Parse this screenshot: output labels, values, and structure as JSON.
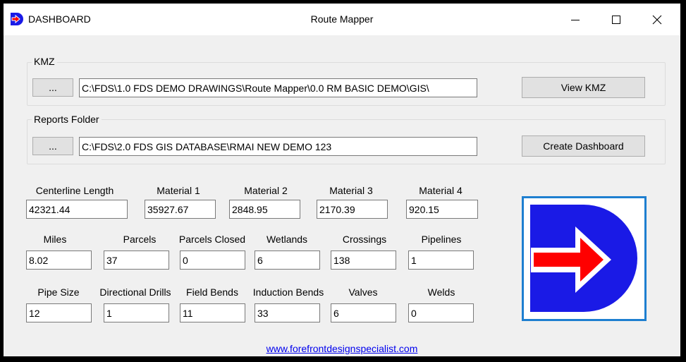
{
  "window": {
    "app_name": "DASHBOARD",
    "title": "Route Mapper",
    "icons": {
      "app": "fds-logo-icon",
      "minimize": "minimize-icon",
      "maximize": "maximize-icon",
      "close": "close-icon"
    }
  },
  "kmz": {
    "group_label": "KMZ",
    "browse_label": "...",
    "path": "C:\\FDS\\1.0 FDS DEMO DRAWINGS\\Route Mapper\\0.0 RM BASIC DEMO\\GIS\\",
    "action_label": "View KMZ"
  },
  "reports": {
    "group_label": "Reports Folder",
    "browse_label": "...",
    "path": "C:\\FDS\\2.0 FDS GIS DATABASE\\RMAI NEW DEMO 123",
    "action_label": "Create Dashboard"
  },
  "fields": {
    "centerline_length": {
      "label": "Centerline Length",
      "value": "42321.44"
    },
    "material_1": {
      "label": "Material 1",
      "value": "35927.67"
    },
    "material_2": {
      "label": "Material 2",
      "value": "2848.95"
    },
    "material_3": {
      "label": "Material 3",
      "value": "2170.39"
    },
    "material_4": {
      "label": "Material 4",
      "value": "920.15"
    },
    "miles": {
      "label": "Miles",
      "value": "8.02"
    },
    "parcels": {
      "label": "Parcels",
      "value": "37"
    },
    "parcels_closed": {
      "label": "Parcels Closed",
      "value": "0"
    },
    "wetlands": {
      "label": "Wetlands",
      "value": "6"
    },
    "crossings": {
      "label": "Crossings",
      "value": "138"
    },
    "pipelines": {
      "label": "Pipelines",
      "value": "1"
    },
    "pipe_size": {
      "label": "Pipe Size",
      "value": "12"
    },
    "directional_drills": {
      "label": "Directional Drills",
      "value": "1"
    },
    "field_bends": {
      "label": "Field Bends",
      "value": "11"
    },
    "induction_bends": {
      "label": "Induction Bends",
      "value": "33"
    },
    "valves": {
      "label": "Valves",
      "value": "6"
    },
    "welds": {
      "label": "Welds",
      "value": "0"
    }
  },
  "logo": {
    "icon": "fds-logo-icon",
    "colors": {
      "blue": "#1a1ae6",
      "red": "#ff0000",
      "border": "#1e7fd0"
    }
  },
  "footer": {
    "link_text": "www.forefrontdesignspecialist.com"
  }
}
